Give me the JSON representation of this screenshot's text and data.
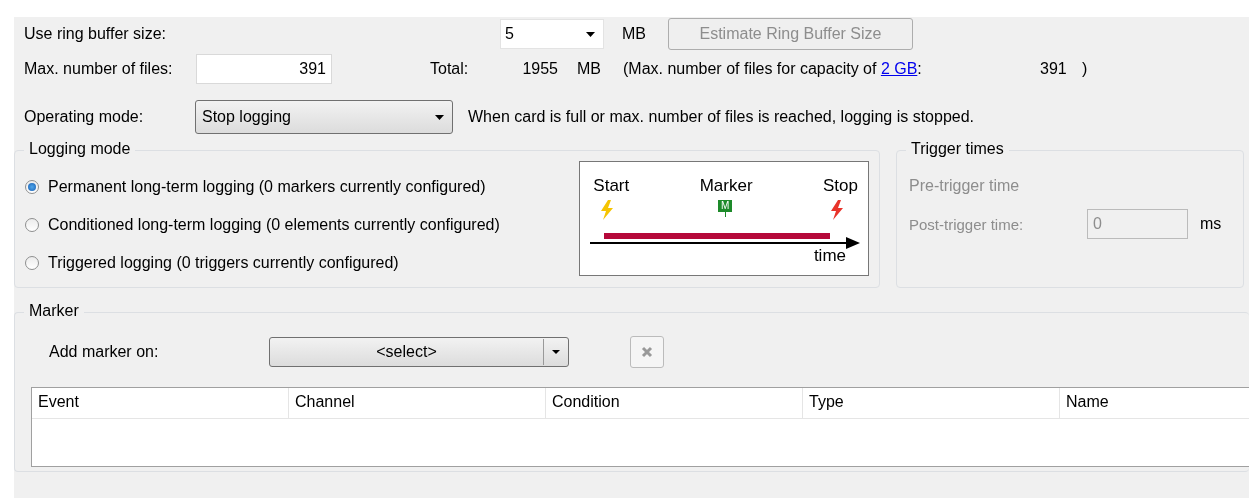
{
  "ring_buffer": {
    "label": "Use ring buffer size:",
    "value": "5",
    "unit": "MB",
    "estimate_button": {
      "label": "Estimate Ring Buffer Size",
      "disabled": true
    }
  },
  "max_files": {
    "label": "Max. number of files:",
    "value": "391"
  },
  "total": {
    "label": "Total:",
    "value": "1955",
    "unit": "MB"
  },
  "capacity_note": {
    "prefix": "(Max. number of files for capacity of",
    "link": "2 GB",
    "suffix": ":",
    "value": "391",
    "close": ")"
  },
  "operating_mode": {
    "label": "Operating mode:",
    "value": "Stop logging",
    "description": "When card is full or max. number of files is reached, logging is stopped."
  },
  "logging_mode": {
    "title": "Logging mode",
    "options": [
      {
        "label": "Permanent long-term logging (0 markers currently configured)",
        "selected": true
      },
      {
        "label": "Conditioned long-term logging (0 elements currently configured)",
        "selected": false
      },
      {
        "label": "Triggered logging (0 triggers currently configured)",
        "selected": false
      }
    ],
    "diagram": {
      "labels": [
        "Start",
        "Marker",
        "Stop"
      ],
      "marker_badge": "M",
      "axis_label": "time"
    }
  },
  "trigger_times": {
    "title": "Trigger times",
    "disabled": true,
    "pre_label": "Pre-trigger time",
    "post_label": "Post-trigger time:",
    "post_value": "0",
    "unit": "ms"
  },
  "marker": {
    "title": "Marker",
    "add_label": "Add marker on:",
    "select_value": "<select>",
    "delete_disabled": true,
    "table": {
      "columns": [
        "Event",
        "Channel",
        "Condition",
        "Type",
        "Name"
      ]
    }
  }
}
